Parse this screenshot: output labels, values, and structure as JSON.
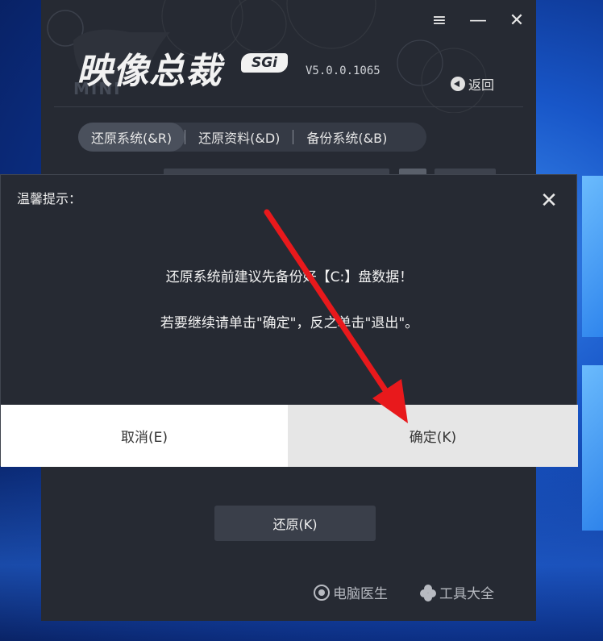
{
  "app": {
    "title": "映像总裁",
    "badge": "SGi",
    "watermark": "MINI",
    "version": "V5.0.0.1065",
    "back_label": "返回",
    "controls": {
      "menu": "≡",
      "minimize": "—",
      "close": "✕"
    },
    "tabs": [
      {
        "label": "还原系统(&R)",
        "active": true
      },
      {
        "label": "还原资料(&D)",
        "active": false
      },
      {
        "label": "备份系统(&B)",
        "active": false
      }
    ],
    "restore_button": "还原(K)",
    "footer": {
      "doctor_label": "电脑医生",
      "tools_label": "工具大全"
    }
  },
  "dialog": {
    "title": "温馨提示：",
    "close_glyph": "✕",
    "message_line1": "还原系统前建议先备份好【C:】盘数据！",
    "message_line2": "若要继续请单击\"确定\"，反之单击\"退出\"。",
    "cancel_label": "取消(E)",
    "ok_label": "确定(K)"
  },
  "colors": {
    "app_bg": "#262a33",
    "arrow": "#e8191c",
    "ok_bg": "#e6e6e6",
    "cancel_bg": "#ffffff"
  }
}
